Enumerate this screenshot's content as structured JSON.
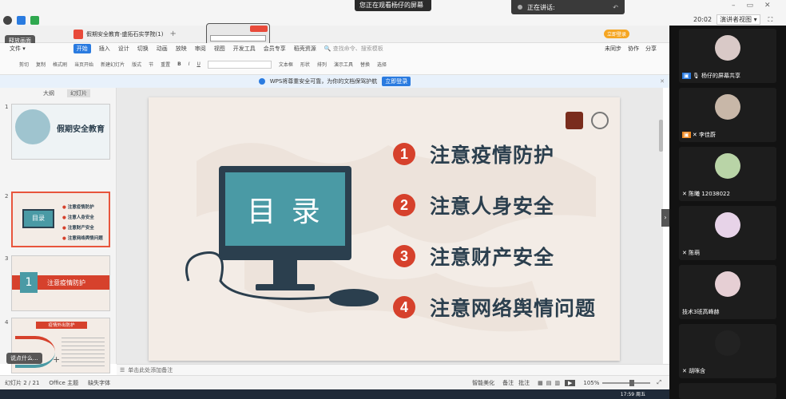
{
  "meeting": {
    "watching_banner": "您正在观看杨仔的屏幕",
    "speaking_label": "正在讲话:",
    "clock": "20:02",
    "presenter_view": "演讲者视图"
  },
  "overlay": {
    "release_screen": "释放画面",
    "say_something": "说点什么..."
  },
  "wps": {
    "file_title": "假期安全教育-盛拓石实学院(1)",
    "login_btn": "立即登录",
    "ribbon_tabs": [
      "开始",
      "插入",
      "设计",
      "切换",
      "动画",
      "放映",
      "审阅",
      "视图",
      "开发工具",
      "会员专享",
      "稻壳资源"
    ],
    "search_cmd": "查找命令、搜索模板",
    "unsync": "未同步",
    "collab": "协作",
    "share": "分享",
    "ribbon_groups": [
      "剪切",
      "复制",
      "格式刷",
      "当页开始",
      "新建幻灯片",
      "版式",
      "节",
      "重置",
      "文本框",
      "形状",
      "排列",
      "演示工具",
      "替换",
      "选择"
    ],
    "notice": "WPS将尊重安全可靠，为你的文档保驾护航",
    "notice_btn": "立即登录",
    "panel_tabs": [
      "大纲",
      "幻灯片"
    ],
    "notes_placeholder": "单击此处添加备注",
    "status_slide": "幻灯片 2 / 21",
    "status_theme": "Office 主题",
    "status_font": "缺失字体",
    "status_beautify": "智能美化",
    "status_notes": "备注",
    "status_comment": "批注",
    "zoom": "105%"
  },
  "thumbnails": [
    {
      "num": "1",
      "title": "假期安全教育"
    },
    {
      "num": "2",
      "title": "目录",
      "items": [
        "注意疫情防护",
        "注意人身安全",
        "注意财产安全",
        "注意网络舆情问题"
      ]
    },
    {
      "num": "3",
      "title": "注意疫情防护",
      "badge": "1"
    },
    {
      "num": "4",
      "title": "疫情外出防护"
    }
  ],
  "slide": {
    "monitor_title": "目 录",
    "toc": [
      {
        "num": "1",
        "text": "注意疫情防护"
      },
      {
        "num": "2",
        "text": "注意人身安全"
      },
      {
        "num": "3",
        "text": "注意财产安全"
      },
      {
        "num": "4",
        "text": "注意网络舆情问题"
      }
    ]
  },
  "participants": [
    {
      "name": "杨仔的屏幕共享",
      "avatar_color": "#d9c9c7"
    },
    {
      "name": "李佳蔚",
      "avatar_color": "#c8b7a8"
    },
    {
      "name": "陈曦 12038022",
      "avatar_color": "#b9d4a7"
    },
    {
      "name": "陈萌",
      "avatar_color": "#e7d3e8"
    },
    {
      "name": "技术3班高峰赫",
      "avatar_color": "#e6cfd4"
    },
    {
      "name": "胡咪含",
      "avatar_color": "#222222"
    }
  ],
  "taskbar": {
    "time": "17:59 周五"
  },
  "colors": {
    "accent_red": "#d6412c",
    "navy": "#2b3f4e",
    "teal": "#4a9aa5",
    "wps_blue": "#2a7be0"
  }
}
